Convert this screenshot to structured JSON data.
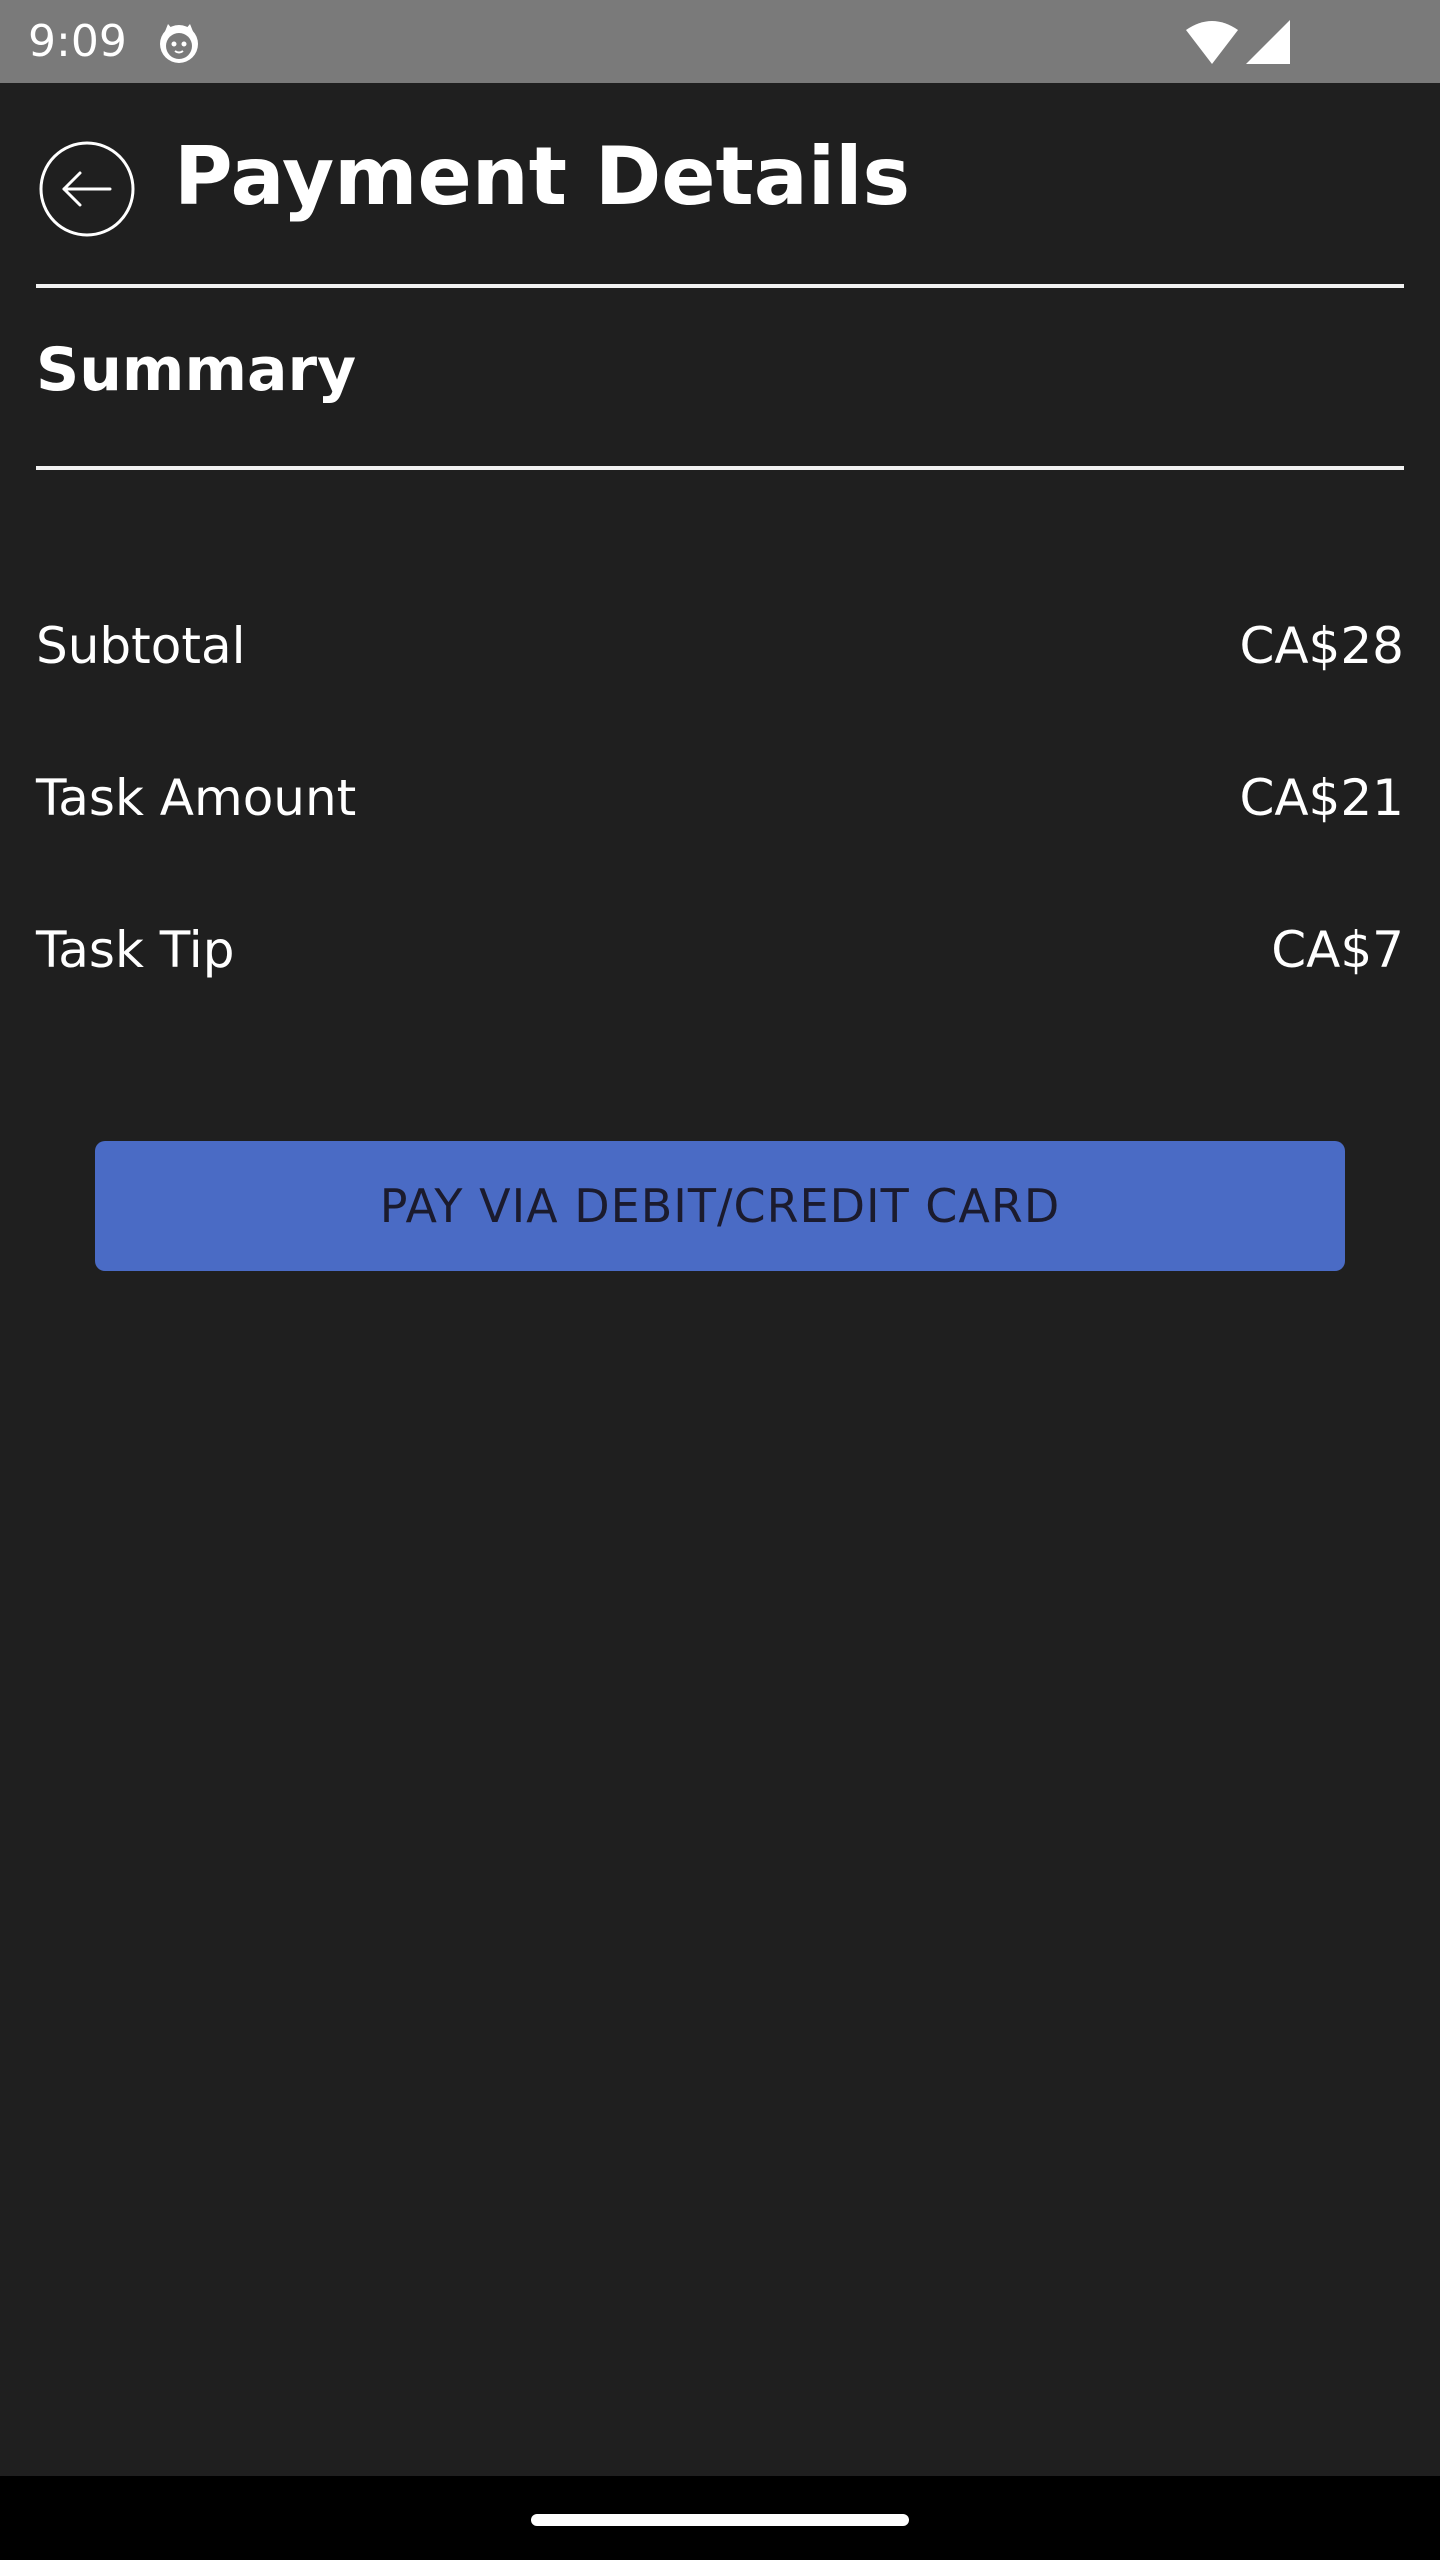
{
  "status_bar": {
    "time": "9:09",
    "app_icon": "cat-face-icon",
    "wifi_icon": "wifi-icon",
    "signal_icon": "cellular-signal-icon"
  },
  "header": {
    "back_icon": "back-arrow-icon",
    "title": "Payment Details"
  },
  "summary": {
    "title": "Summary",
    "rows": [
      {
        "label": "Subtotal",
        "value": "CA$28"
      },
      {
        "label": "Task Amount",
        "value": "CA$21"
      },
      {
        "label": "Task Tip",
        "value": "CA$7"
      }
    ]
  },
  "pay_button": {
    "label": "PAY VIA DEBIT/CREDIT CARD"
  },
  "colors": {
    "background": "#1f1f1f",
    "status_bar": "#7a7a7a",
    "accent": "#4a6bc5",
    "text": "#ffffff",
    "button_text": "#1b1b2e",
    "nav_bar": "#000000"
  }
}
